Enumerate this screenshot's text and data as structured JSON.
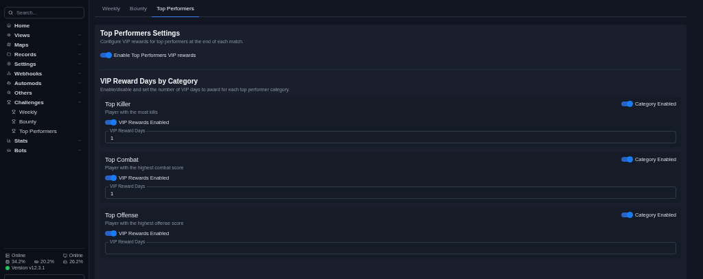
{
  "sidebar": {
    "search": {
      "placeholder": "Search..."
    },
    "items": [
      {
        "kind": "link",
        "label": "Home"
      },
      {
        "kind": "group",
        "label": "Views",
        "expanded": false
      },
      {
        "kind": "group",
        "label": "Maps",
        "expanded": false
      },
      {
        "kind": "group",
        "label": "Records",
        "expanded": false
      },
      {
        "kind": "group",
        "label": "Settings",
        "expanded": false
      },
      {
        "kind": "group",
        "label": "Webhooks",
        "expanded": false
      },
      {
        "kind": "group",
        "label": "Automods",
        "expanded": false
      },
      {
        "kind": "group",
        "label": "Others",
        "expanded": false
      },
      {
        "kind": "group",
        "label": "Challenges",
        "expanded": true,
        "children": [
          {
            "label": "Weekly"
          },
          {
            "label": "Bounty"
          },
          {
            "label": "Top Performers"
          }
        ]
      },
      {
        "kind": "group",
        "label": "Stats",
        "expanded": false
      },
      {
        "kind": "group",
        "label": "Bots",
        "expanded": false
      }
    ],
    "status": {
      "server": "Online",
      "client": "Online",
      "cpu": "34.2%",
      "memory": "20.2%",
      "disk": "26.2%",
      "version": "Version v12.3.1"
    }
  },
  "tabs": [
    {
      "label": "Weekly",
      "selected": false
    },
    {
      "label": "Bounty",
      "selected": false
    },
    {
      "label": "Top Performers",
      "selected": true
    }
  ],
  "settings": {
    "title": "Top Performers Settings",
    "description": "Configure VIP rewards for top performers at the end of each match.",
    "toggle": {
      "label": "Enable Top Performers VIP rewards",
      "on": true
    }
  },
  "categories_section": {
    "title": "VIP Reward Days by Category",
    "description": "Enable/disable and set the number of VIP days to award for each top performer category.",
    "categories": [
      {
        "title": "Top Killer",
        "description": "Player with the most kills",
        "enabled": {
          "label": "Category Enabled",
          "on": true
        },
        "vip": {
          "label": "VIP Rewards Enabled",
          "on": true
        },
        "field": {
          "label": "VIP Reward Days",
          "value": "1"
        }
      },
      {
        "title": "Top Combat",
        "description": "Player with the highest combat score",
        "enabled": {
          "label": "Category Enabled",
          "on": true
        },
        "vip": {
          "label": "VIP Rewards Enabled",
          "on": true
        },
        "field": {
          "label": "VIP Reward Days",
          "value": "1"
        }
      },
      {
        "title": "Top Offense",
        "description": "Player with the highest offense score",
        "enabled": {
          "label": "Category Enabled",
          "on": true
        },
        "vip": {
          "label": "VIP Rewards Enabled",
          "on": true
        },
        "field": {
          "label": "VIP Reward Days"
        }
      }
    ]
  }
}
